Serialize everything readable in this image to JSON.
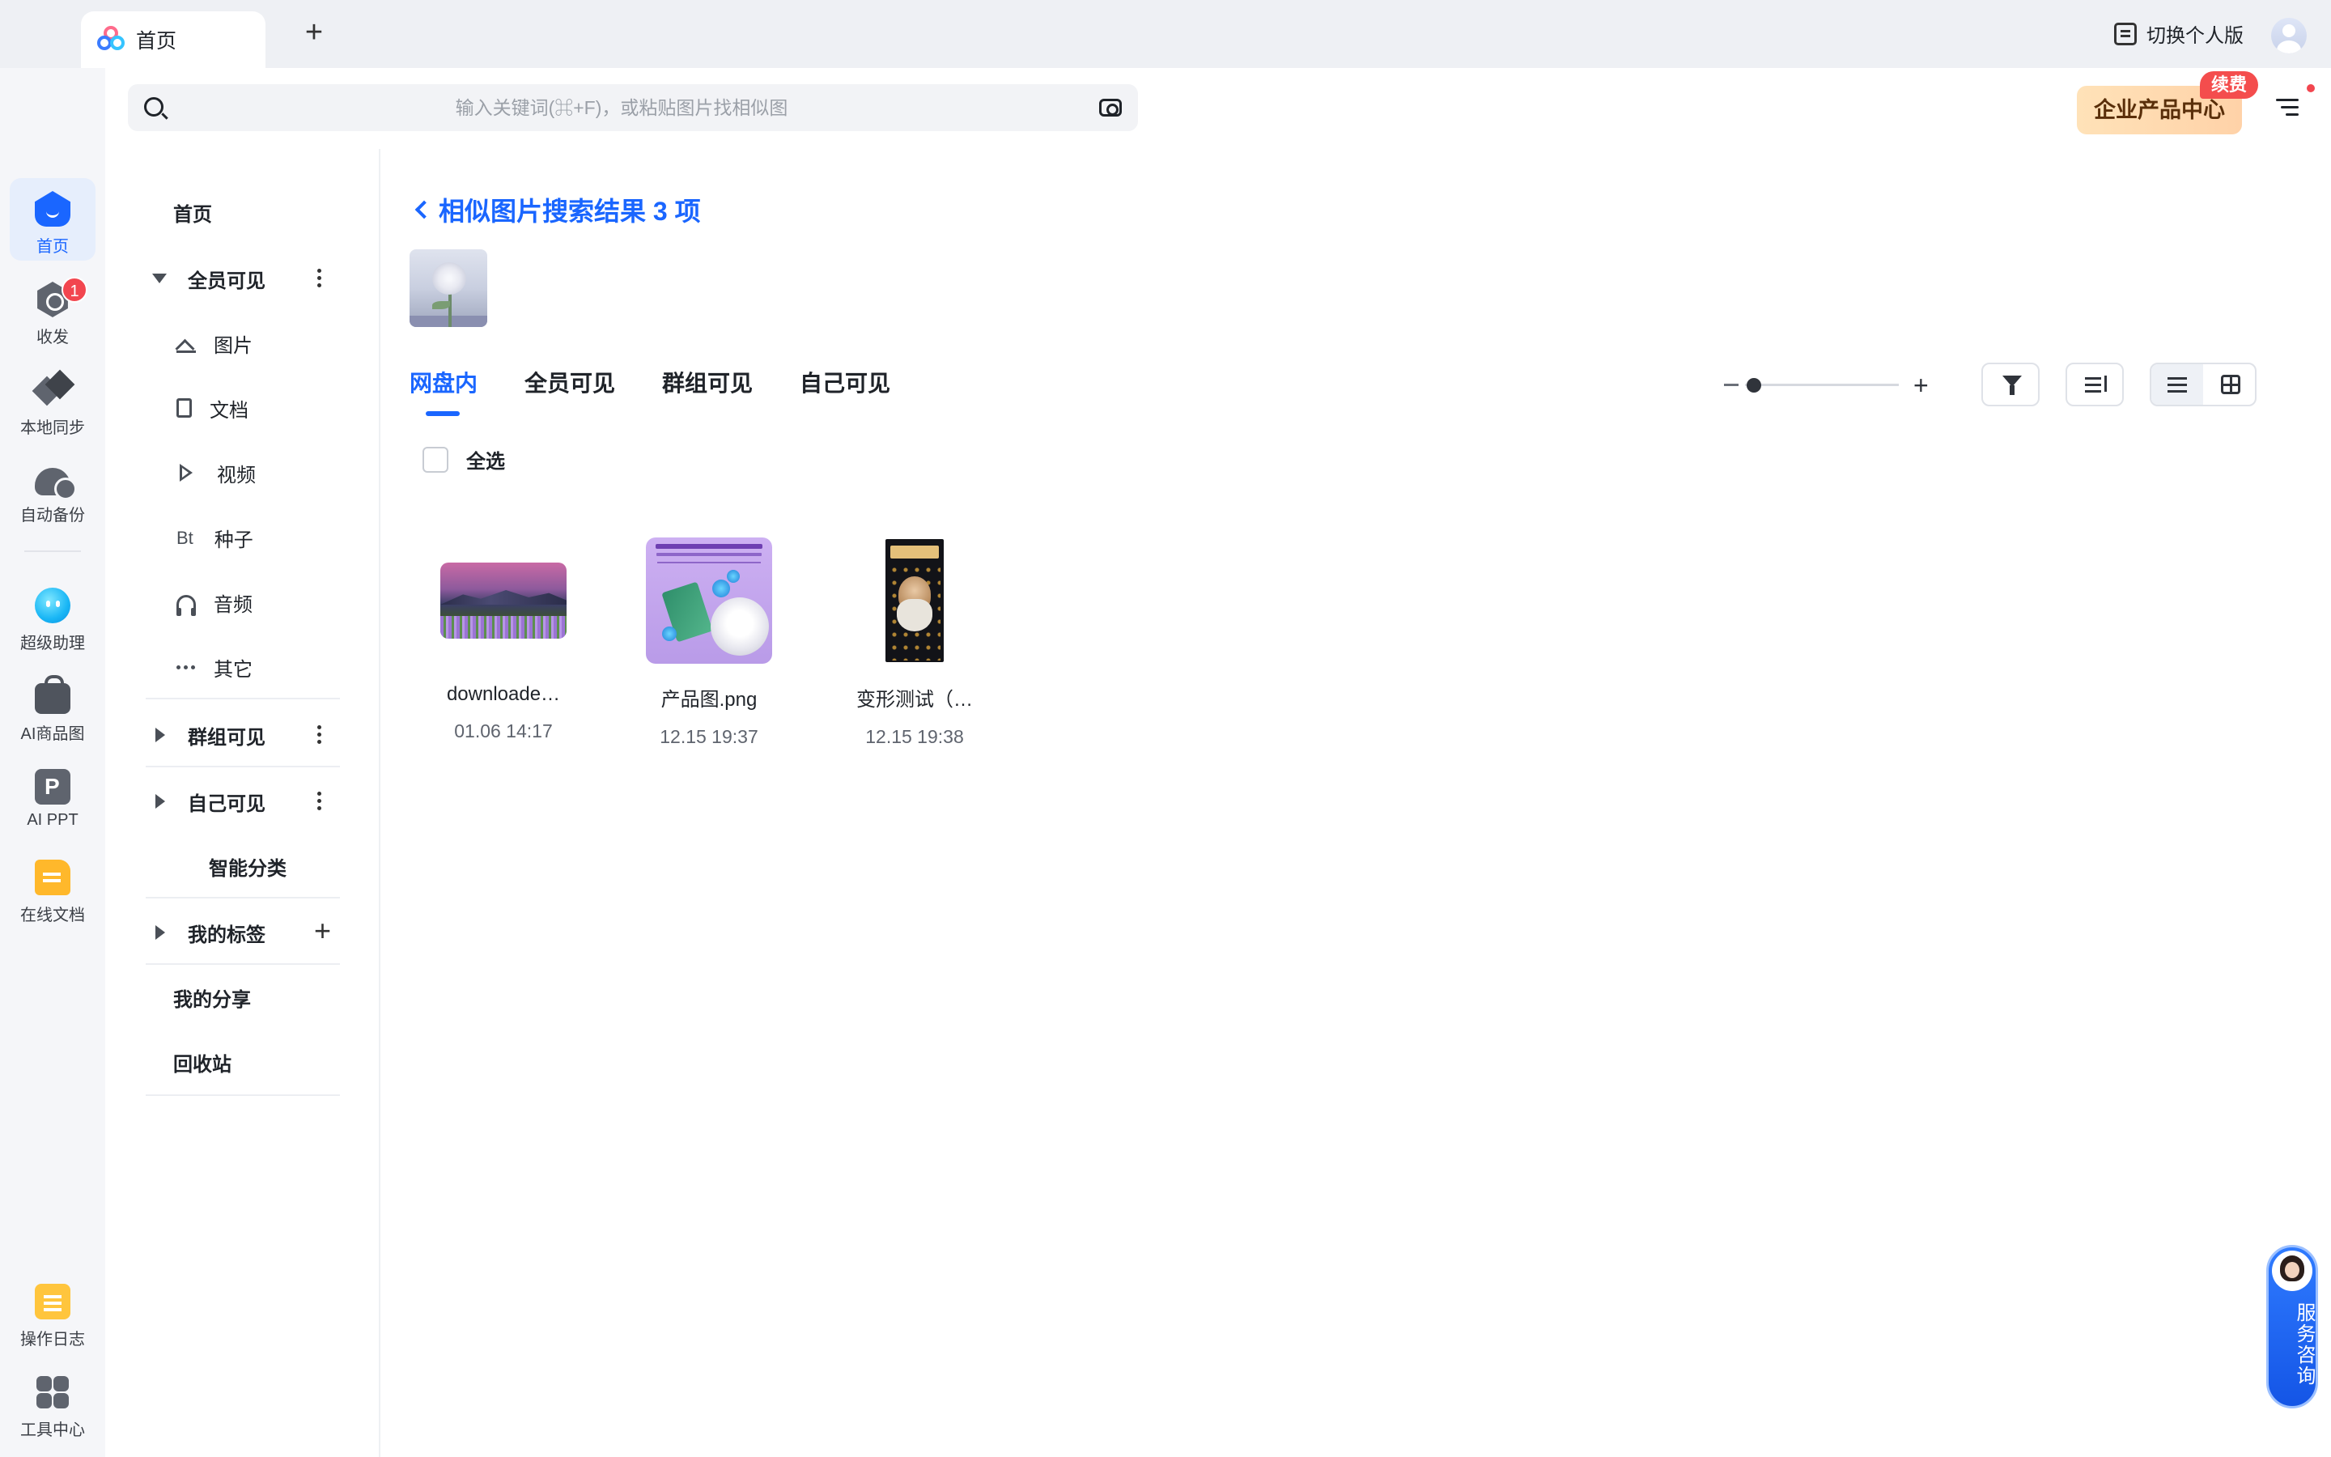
{
  "tab": {
    "label": "首页"
  },
  "header": {
    "switch_label": "切换个人版"
  },
  "search": {
    "placeholder": "输入关键词(⌘+F)，或粘贴图片找相似图"
  },
  "enterprise": {
    "label": "企业产品中心",
    "badge": "续费"
  },
  "rail": {
    "items": [
      {
        "label": "首页",
        "icon": "home-icon",
        "active": true
      },
      {
        "label": "收发",
        "icon": "transfer-icon",
        "badge": "1"
      },
      {
        "label": "本地同步",
        "icon": "sync-icon"
      },
      {
        "label": "自动备份",
        "icon": "backup-icon"
      },
      {
        "label": "超级助理",
        "icon": "assistant-icon"
      },
      {
        "label": "AI商品图",
        "icon": "ai-product-icon"
      },
      {
        "label": "AI PPT",
        "icon": "ai-ppt-icon"
      },
      {
        "label": "在线文档",
        "icon": "online-doc-icon"
      },
      {
        "label": "操作日志",
        "icon": "log-icon"
      },
      {
        "label": "工具中心",
        "icon": "tools-icon"
      }
    ]
  },
  "tree": {
    "home": "首页",
    "all_visible": "全员可见",
    "types": [
      {
        "label": "图片",
        "icon": "image-icon"
      },
      {
        "label": "文档",
        "icon": "document-icon"
      },
      {
        "label": "视频",
        "icon": "video-icon"
      },
      {
        "label": "种子",
        "icon": "bt-icon",
        "icon_text": "Bt"
      },
      {
        "label": "音频",
        "icon": "audio-icon"
      },
      {
        "label": "其它",
        "icon": "more-icon"
      }
    ],
    "group_visible": "群组可见",
    "self_visible": "自己可见",
    "smart_category": "智能分类",
    "my_tags": "我的标签",
    "my_share": "我的分享",
    "recycle_bin": "回收站"
  },
  "results": {
    "title": "相似图片搜索结果 3 项",
    "tabs": [
      "网盘内",
      "全员可见",
      "群组可见",
      "自己可见"
    ],
    "active_tab": 0,
    "select_all": "全选",
    "files": [
      {
        "name": "downloade…",
        "date": "01.06 14:17"
      },
      {
        "name": "产品图.png",
        "date": "12.15 19:37"
      },
      {
        "name": "变形测试（…",
        "date": "12.15 19:38"
      }
    ]
  },
  "service": {
    "label": "服务咨询"
  },
  "colors": {
    "accent": "#1a66ff",
    "badge": "#f2464f",
    "enterprise_bg": "#ffe2b8"
  }
}
